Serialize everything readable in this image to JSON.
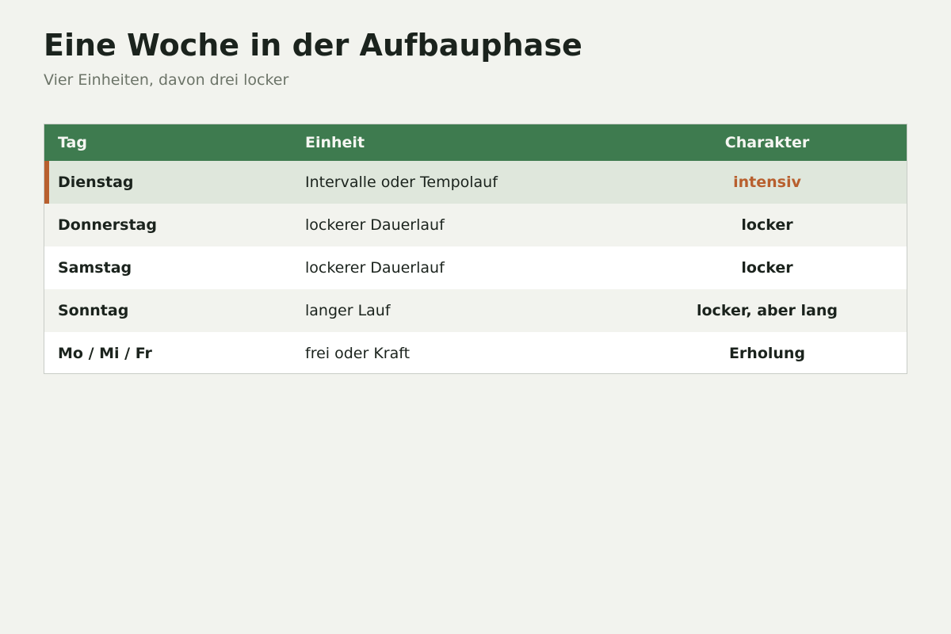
{
  "header": {
    "title": "Eine Woche in der Aufbauphase",
    "subtitle": "Vier Einheiten, davon drei locker"
  },
  "table": {
    "columns": [
      "Tag",
      "Einheit",
      "Charakter"
    ],
    "rows": [
      {
        "day": "Dienstag",
        "session": "Intervalle oder Tempolauf",
        "character": "intensiv",
        "highlighted": true
      },
      {
        "day": "Donnerstag",
        "session": "lockerer Dauerlauf",
        "character": "locker"
      },
      {
        "day": "Samstag",
        "session": "lockerer Dauerlauf",
        "character": "locker"
      },
      {
        "day": "Sonntag",
        "session": "langer Lauf",
        "character": "locker, aber lang"
      },
      {
        "day": "Mo / Mi / Fr",
        "session": "frei oder Kraft",
        "character": "Erholung"
      }
    ]
  },
  "colors": {
    "background": "#f2f3ee",
    "header_green": "#3e7b4f",
    "accent_orange": "#b85f2e",
    "highlight_row": "#dfe7dc"
  }
}
